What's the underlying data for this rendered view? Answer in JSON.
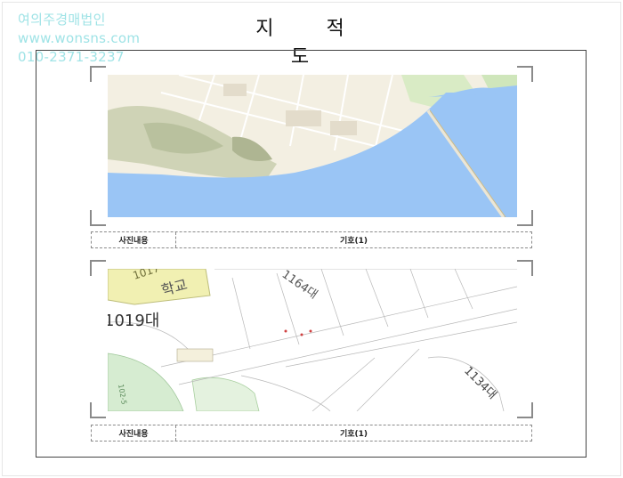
{
  "watermark": {
    "company": "여의주경매법인",
    "website": "www.wonsns.com",
    "phone": "010-2371-3237"
  },
  "page": {
    "title": "지 적 도"
  },
  "photos": [
    {
      "caption_label": "사진내용",
      "caption_value": "기호(1)"
    },
    {
      "caption_label": "사진내용",
      "caption_value": "기호(1)",
      "map_labels": [
        "1017",
        "학교",
        "1164대",
        "1019대",
        "1134대",
        "102-5"
      ]
    }
  ]
}
